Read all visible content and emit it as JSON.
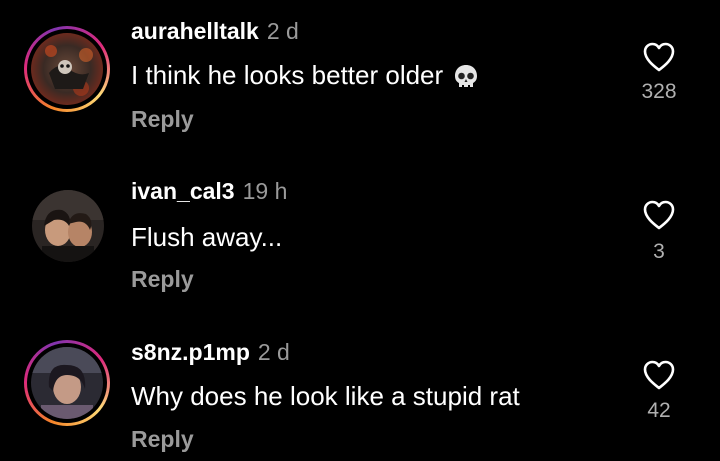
{
  "comments": [
    {
      "username": "aurahelltalk",
      "time": "2 d",
      "text": "I think he looks better older",
      "emoji": "skull-emoji",
      "reply": "Reply",
      "likes": "328",
      "story_ring": true
    },
    {
      "username": "ivan_cal3",
      "time": "19 h",
      "text": "Flush away...",
      "reply": "Reply",
      "likes": "3",
      "story_ring": false
    },
    {
      "username": "s8nz.p1mp",
      "time": "2 d",
      "text": "Why does he look like a stupid rat",
      "reply": "Reply",
      "likes": "42",
      "story_ring": true
    }
  ],
  "icons": {
    "like": "heart-outline-icon"
  },
  "colors": {
    "background": "#000000",
    "text": "#ffffff",
    "muted": "#9a9a9a",
    "story_gradient": [
      "#f58529",
      "#dd2a7b",
      "#8134af"
    ]
  }
}
